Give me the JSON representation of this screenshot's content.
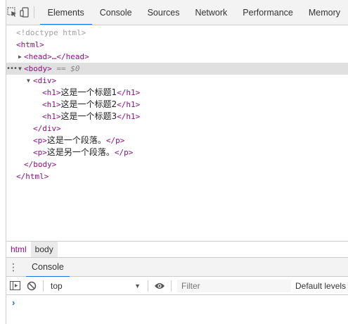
{
  "toolbar": {
    "tabs": [
      {
        "label": "Elements"
      },
      {
        "label": "Console"
      },
      {
        "label": "Sources"
      },
      {
        "label": "Network"
      },
      {
        "label": "Performance"
      },
      {
        "label": "Memory"
      }
    ]
  },
  "dom": {
    "doctype": "<!doctype html>",
    "html_open": "<html>",
    "head": "<head>…</head>",
    "body_open": "<body>",
    "body_eq": "== $0",
    "div_open": "<div>",
    "h1_open": "<h1>",
    "h1_close": "</h1>",
    "h1_texts": [
      "这是一个标题1",
      "这是一个标题2",
      "这是一个标题3"
    ],
    "div_close": "</div>",
    "p_open": "<p>",
    "p_close": "</p>",
    "p_texts": [
      "这是一个段落。",
      "这是另一个段落。"
    ],
    "body_close": "</body>",
    "html_close": "</html>"
  },
  "breadcrumbs": [
    {
      "label": "html"
    },
    {
      "label": "body"
    }
  ],
  "drawer": {
    "tab": "Console"
  },
  "console": {
    "context": "top",
    "filter_placeholder": "Filter",
    "levels": "Default levels",
    "prompt": "›"
  }
}
